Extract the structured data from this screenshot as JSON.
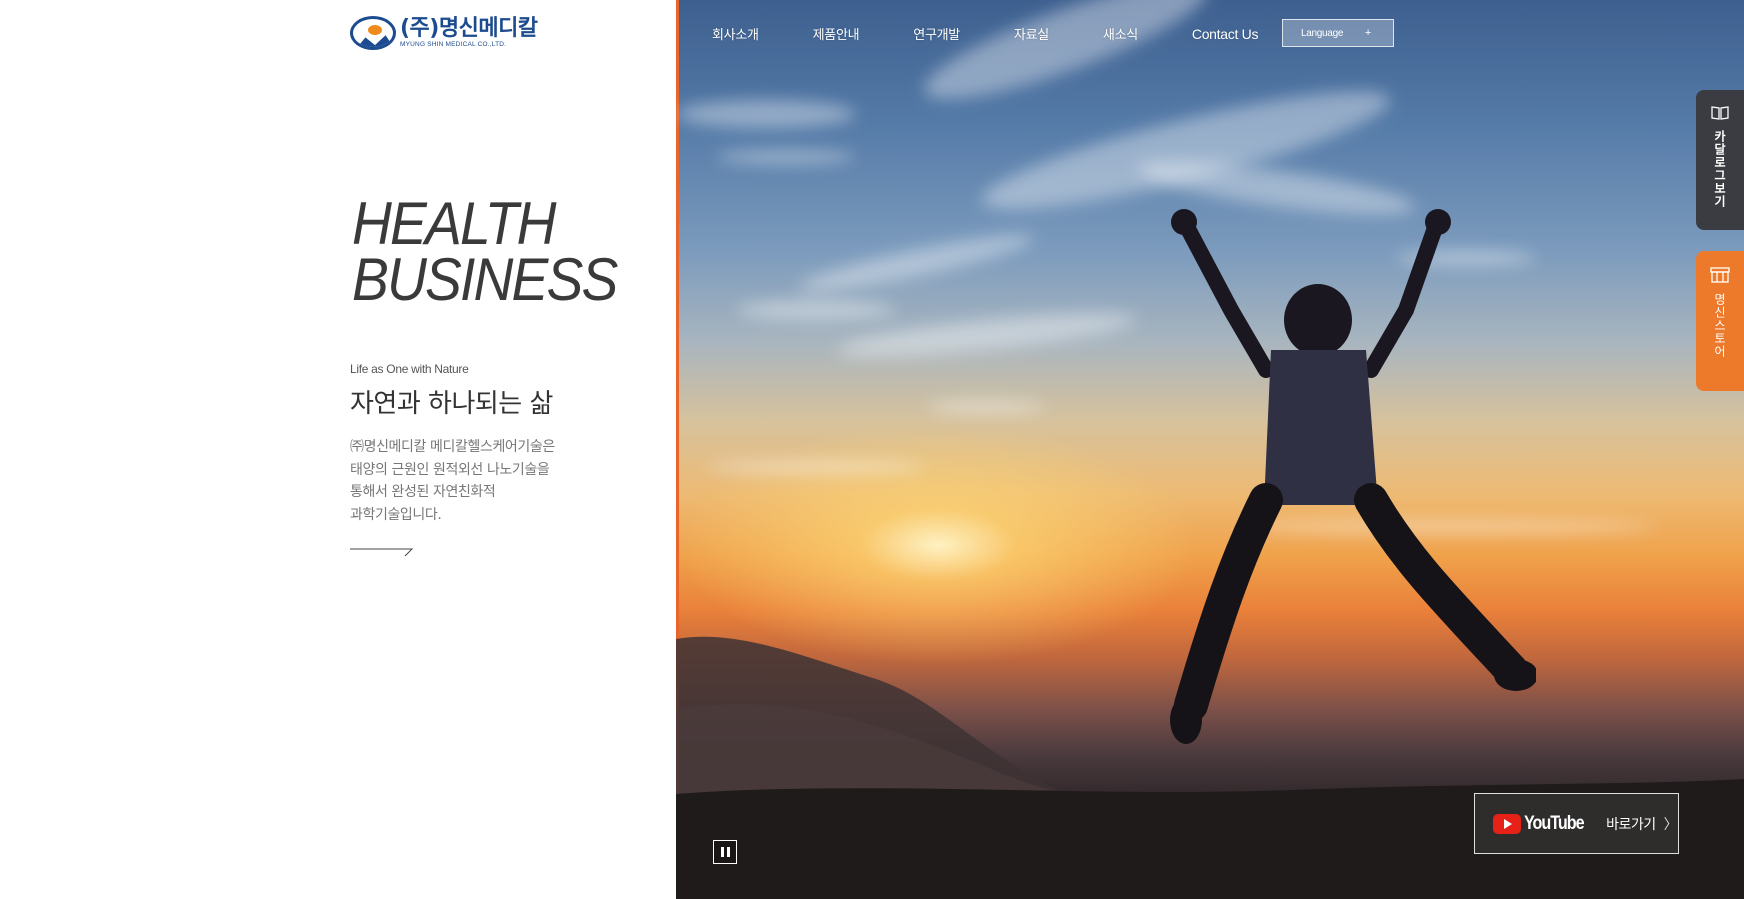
{
  "header": {
    "logo_title": "(주)명신메디칼",
    "logo_subtitle": "MYUNG SHIN MEDICAL CO.,LTD.",
    "nav": [
      {
        "label": "회사소개"
      },
      {
        "label": "제품안내"
      },
      {
        "label": "연구개발"
      },
      {
        "label": "자료실"
      },
      {
        "label": "새소식"
      },
      {
        "label": "Contact Us"
      }
    ],
    "language_label": "Language",
    "language_icon": "+"
  },
  "hero": {
    "title_line1": "HEALTH",
    "title_line2": "BUSINESS",
    "tagline_en": "Life as One with Nature",
    "tagline_ko": "자연과 하나되는 삶",
    "description_lines": [
      "㈜명신메디칼 메디칼헬스케어기술은",
      "태양의 근원인 원적외선 나노기술을",
      "통해서 완성된 자연친화적",
      "과학기술입니다."
    ],
    "more_icon": "arrow-right-icon"
  },
  "side_tabs": {
    "catalog_label": "카달로그보기",
    "catalog_icon": "book-icon",
    "store_label": "명신스토어",
    "store_icon": "store-icon"
  },
  "controls": {
    "pause_icon": "pause-icon",
    "youtube_word": "YouTube",
    "youtube_goto": "바로가기",
    "youtube_chevron": "〉"
  },
  "colors": {
    "brand_blue": "#1d4b8f",
    "accent_orange": "#ec7a2a",
    "catalog_dark": "#3a3c41",
    "youtube_red": "#e62117"
  }
}
